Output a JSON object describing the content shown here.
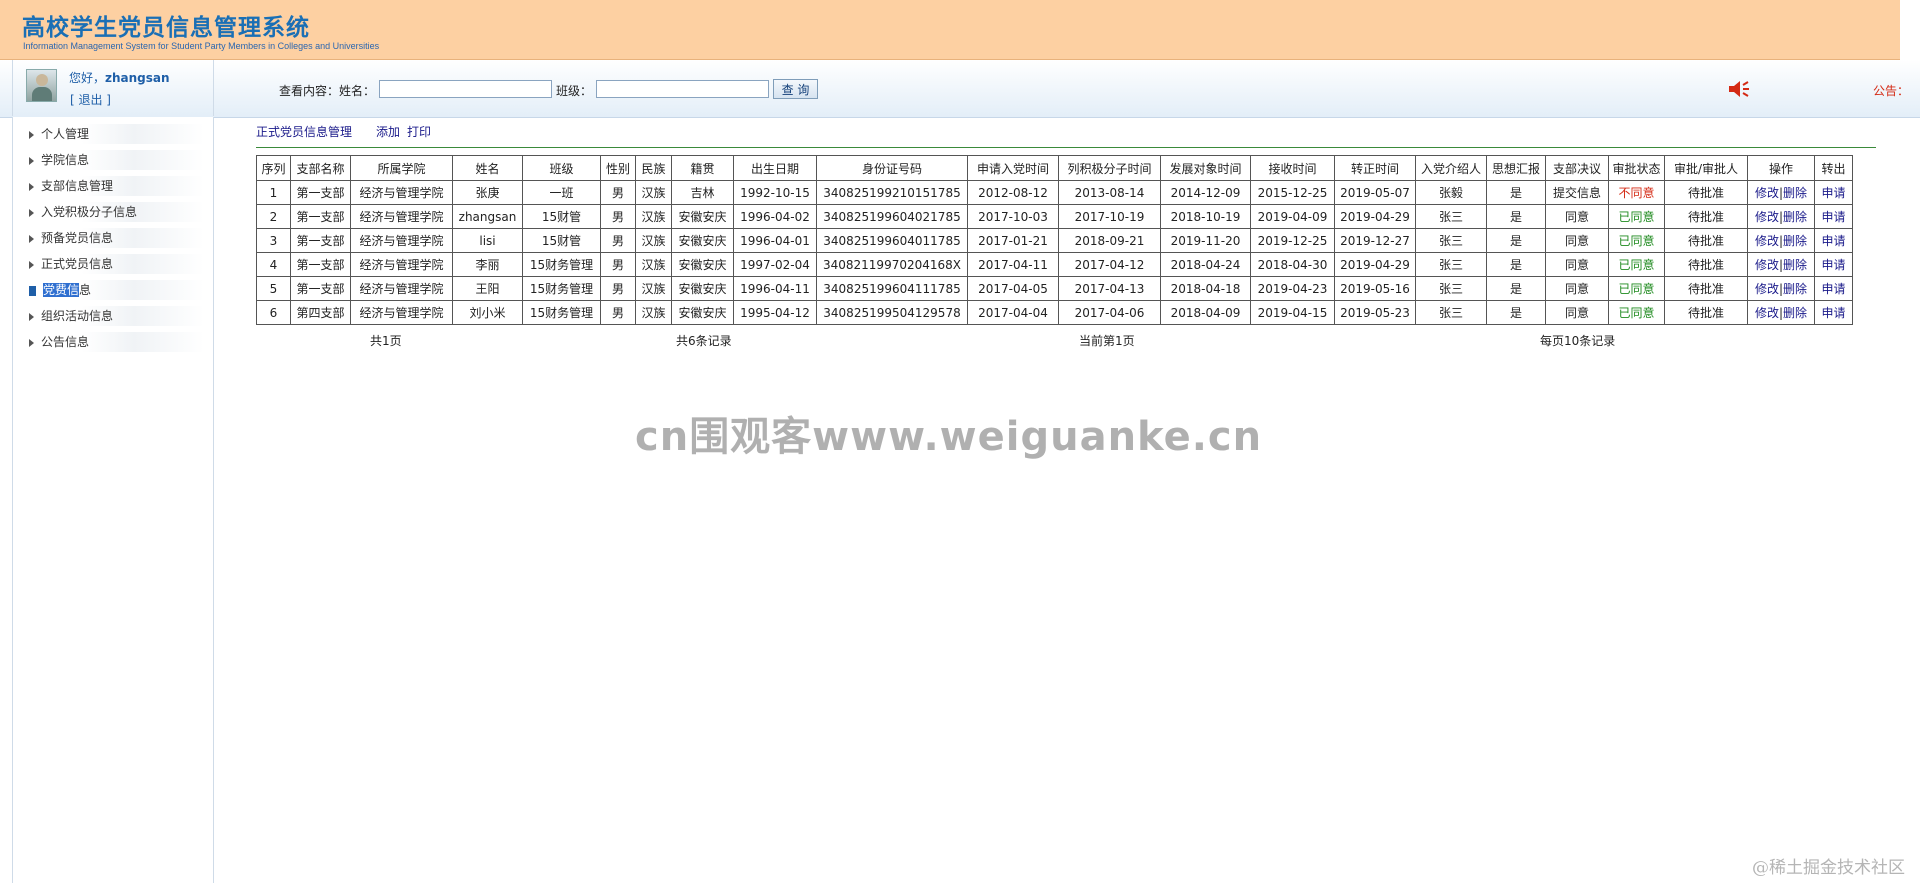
{
  "header": {
    "title": "高校学生党员信息管理系统",
    "subtitle": "Information Management System for Student Party Members in Colleges and Universities"
  },
  "user": {
    "greeting_prefix": "您好，",
    "name": "zhangsan",
    "logout": "[ 退出 ]"
  },
  "search": {
    "label_content": "查看内容：",
    "label_name": "姓名：",
    "name_value": "",
    "label_class": "班级：",
    "class_value": "",
    "button": "查 询"
  },
  "notice": {
    "label": "公告：",
    "icon": "speaker-icon",
    "color": "#d42a14"
  },
  "sidebar": {
    "items": [
      {
        "label": "个人管理"
      },
      {
        "label": "学院信息"
      },
      {
        "label": "支部信息管理"
      },
      {
        "label": "入党积极分子信息"
      },
      {
        "label": "预备党员信息"
      },
      {
        "label": "正式党员信息"
      },
      {
        "label_highlight": "党费信",
        "label_rest": "息",
        "active": true
      },
      {
        "label": "组织活动信息"
      },
      {
        "label": "公告信息"
      }
    ]
  },
  "main": {
    "breadcrumb": "正式党员信息管理",
    "add": "添加",
    "print": "打印"
  },
  "table": {
    "headers": [
      "序列",
      "支部名称",
      "所属学院",
      "姓名",
      "班级",
      "性别",
      "民族",
      "籍贯",
      "出生日期",
      "身份证号码",
      "申请入党时间",
      "列积极分子时间",
      "发展对象时间",
      "接收时间",
      "转正时间",
      "入党介绍人",
      "思想汇报",
      "支部决议",
      "审批状态",
      "审批/审批人",
      "操作",
      "转出"
    ],
    "rows": [
      [
        "1",
        "第一支部",
        "经济与管理学院",
        "张庚",
        "一班",
        "男",
        "汉族",
        "吉林",
        "1992-10-15",
        "340825199210151785",
        "2012-08-12",
        "2013-08-14",
        "2014-12-09",
        "2015-12-25",
        "2019-05-07",
        "张毅",
        "是",
        "提交信息",
        "不同意",
        "待批准",
        "修改",
        "删除",
        "申请"
      ],
      [
        "2",
        "第一支部",
        "经济与管理学院",
        "zhangsan",
        "15财管",
        "男",
        "汉族",
        "安徽安庆",
        "1996-04-02",
        "340825199604021785",
        "2017-10-03",
        "2017-10-19",
        "2018-10-19",
        "2019-04-09",
        "2019-04-29",
        "张三",
        "是",
        "同意",
        "已同意",
        "待批准",
        "修改",
        "删除",
        "申请"
      ],
      [
        "3",
        "第一支部",
        "经济与管理学院",
        "lisi",
        "15财管",
        "男",
        "汉族",
        "安徽安庆",
        "1996-04-01",
        "340825199604011785",
        "2017-01-21",
        "2018-09-21",
        "2019-11-20",
        "2019-12-25",
        "2019-12-27",
        "张三",
        "是",
        "同意",
        "已同意",
        "待批准",
        "修改",
        "删除",
        "申请"
      ],
      [
        "4",
        "第一支部",
        "经济与管理学院",
        "李丽",
        "15财务管理",
        "男",
        "汉族",
        "安徽安庆",
        "1997-02-04",
        "34082119970204168X",
        "2017-04-11",
        "2017-04-12",
        "2018-04-24",
        "2018-04-30",
        "2019-04-29",
        "张三",
        "是",
        "同意",
        "已同意",
        "待批准",
        "修改",
        "删除",
        "申请"
      ],
      [
        "5",
        "第一支部",
        "经济与管理学院",
        "王阳",
        "15财务管理",
        "男",
        "汉族",
        "安徽安庆",
        "1996-04-11",
        "340825199604111785",
        "2017-04-05",
        "2017-04-13",
        "2018-04-18",
        "2019-04-23",
        "2019-05-16",
        "张三",
        "是",
        "同意",
        "已同意",
        "待批准",
        "修改",
        "删除",
        "申请"
      ],
      [
        "6",
        "第四支部",
        "经济与管理学院",
        "刘小米",
        "15财务管理",
        "男",
        "汉族",
        "安徽安庆",
        "1995-04-12",
        "340825199504129578",
        "2017-04-04",
        "2017-04-06",
        "2018-04-09",
        "2019-04-15",
        "2019-05-23",
        "张三",
        "是",
        "同意",
        "已同意",
        "待批准",
        "修改",
        "删除",
        "申请"
      ]
    ],
    "status_colors": {
      "不同意": "#d42a14",
      "已同意": "#1e8a1e"
    },
    "op_separator": "|"
  },
  "pager": {
    "total_pages": "共1页",
    "total_records": "共6条记录",
    "current_page": "当前第1页",
    "per_page": "每页10条记录"
  },
  "watermark": "cn围观客www.weiguanke.cn",
  "corner_mark": "@稀土掘金技术社区"
}
